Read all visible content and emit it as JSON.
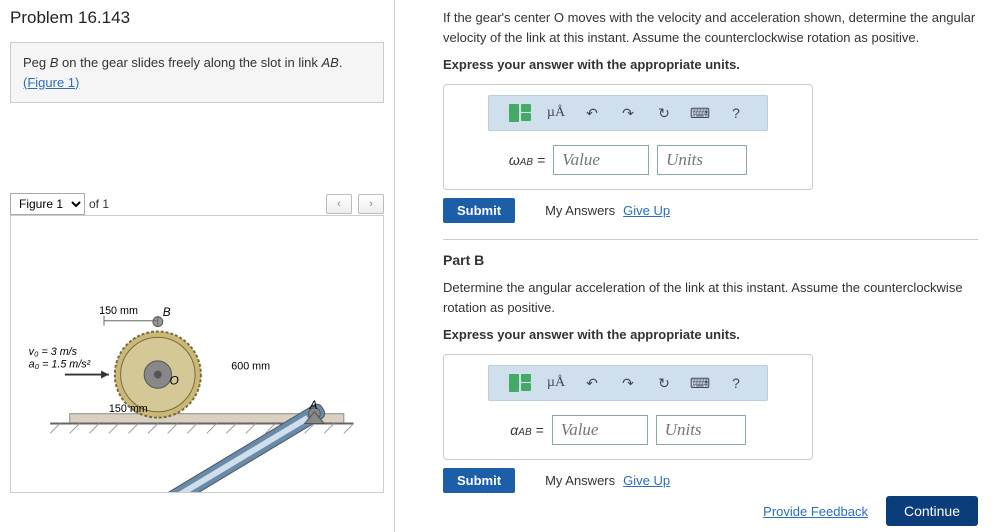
{
  "problem": {
    "title": "Problem 16.143",
    "note_pre": "Peg ",
    "note_peg": "B",
    "note_mid": " on the gear slides freely along the slot in link ",
    "note_link": "AB",
    "note_post": ".",
    "figure_link": "(Figure 1)"
  },
  "figure": {
    "selector": "Figure 1",
    "of": "of 1",
    "prev": "‹",
    "next": "›",
    "labels": {
      "top_dim": "150 mm",
      "B": "B",
      "vo": "v₀ = 3 m/s",
      "ao": "a₀ = 1.5 m/s²",
      "link_dim": "600 mm",
      "O": "O",
      "bottom_dim": "150 mm",
      "A": "A"
    }
  },
  "partA": {
    "prompt": "If the gear's center O moves with the velocity and acceleration shown, determine the angular velocity of the link at this instant. Assume the counterclockwise rotation as positive.",
    "express": "Express your answer with the appropriate units.",
    "var": "ω",
    "sub": "AB",
    "eq": " = ",
    "value_ph": "Value",
    "units_ph": "Units",
    "submit": "Submit",
    "my_answers": "My Answers",
    "giveup": "Give Up"
  },
  "partB": {
    "title": "Part B",
    "prompt": "Determine the angular acceleration of the link at this instant. Assume the counterclockwise rotation as positive.",
    "express": "Express your answer with the appropriate units.",
    "var": "α",
    "sub": "AB",
    "eq": " = ",
    "value_ph": "Value",
    "units_ph": "Units",
    "submit": "Submit",
    "my_answers": "My Answers",
    "giveup": "Give Up"
  },
  "toolbar": {
    "mu": "µÅ",
    "undo": "↶",
    "redo": "↷",
    "reset": "↻",
    "keyboard": "⌨",
    "help": "?"
  },
  "footer": {
    "feedback": "Provide Feedback",
    "continue": "Continue"
  }
}
